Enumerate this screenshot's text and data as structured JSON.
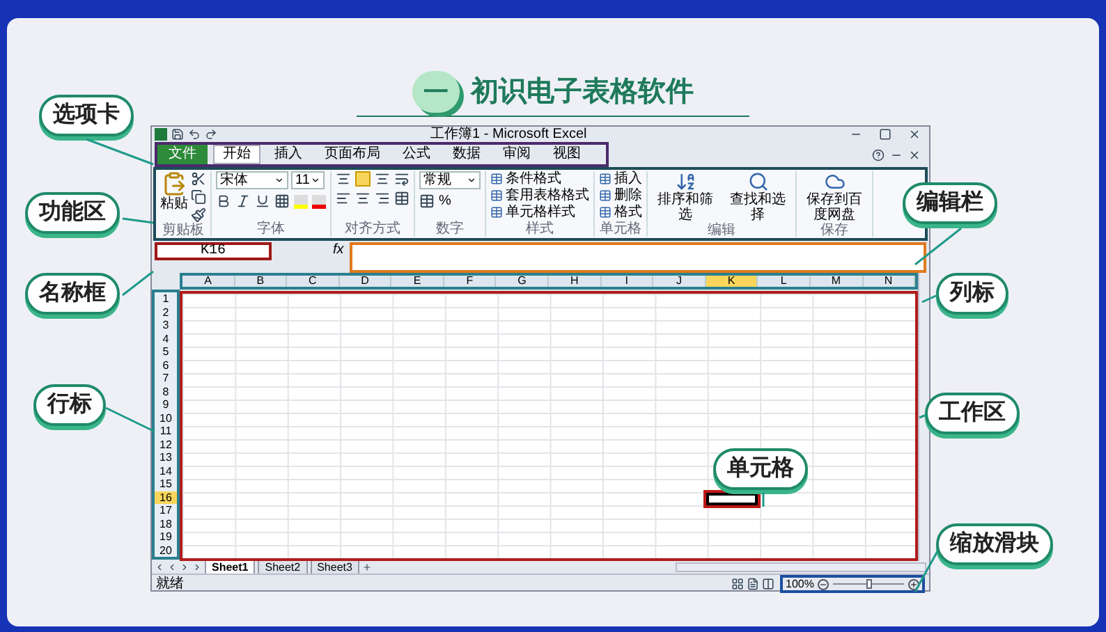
{
  "slide_title": {
    "number": "一",
    "text": "初识电子表格软件"
  },
  "excel": {
    "title": "工作簿1 - Microsoft Excel",
    "tabs": [
      {
        "label": "文件",
        "kind": "file",
        "selected": false
      },
      {
        "label": "开始",
        "kind": "tab",
        "selected": true
      },
      {
        "label": "插入",
        "kind": "tab",
        "selected": false
      },
      {
        "label": "页面布局",
        "kind": "tab",
        "selected": false
      },
      {
        "label": "公式",
        "kind": "tab",
        "selected": false
      },
      {
        "label": "数据",
        "kind": "tab",
        "selected": false
      },
      {
        "label": "审阅",
        "kind": "tab",
        "selected": false
      },
      {
        "label": "视图",
        "kind": "tab",
        "selected": false
      }
    ],
    "ribbon_groups": [
      {
        "kind": "clipboard",
        "label": "剪贴板",
        "items": [
          "粘贴"
        ]
      },
      {
        "kind": "font",
        "label": "字体",
        "items": [
          "宋体",
          "11"
        ]
      },
      {
        "kind": "align",
        "label": "对齐方式"
      },
      {
        "kind": "number",
        "label": "数字",
        "items": [
          "常规",
          "%"
        ]
      },
      {
        "kind": "list",
        "label": "样式",
        "items": [
          "条件格式",
          "套用表格格式",
          "单元格样式"
        ]
      },
      {
        "kind": "list",
        "label": "单元格",
        "items": [
          "插入",
          "删除",
          "格式"
        ]
      },
      {
        "kind": "big",
        "label": "编辑",
        "items": [
          "排序和筛选",
          "查找和选择"
        ]
      },
      {
        "kind": "big",
        "label": "保存",
        "items": [
          "保存到百度网盘"
        ]
      }
    ],
    "name_box": "K16",
    "fx": "fx",
    "columns": [
      {
        "label": "A",
        "selected": false
      },
      {
        "label": "B",
        "selected": false
      },
      {
        "label": "C",
        "selected": false
      },
      {
        "label": "D",
        "selected": false
      },
      {
        "label": "E",
        "selected": false
      },
      {
        "label": "F",
        "selected": false
      },
      {
        "label": "G",
        "selected": false
      },
      {
        "label": "H",
        "selected": false
      },
      {
        "label": "I",
        "selected": false
      },
      {
        "label": "J",
        "selected": false
      },
      {
        "label": "K",
        "selected": true
      },
      {
        "label": "L",
        "selected": false
      },
      {
        "label": "M",
        "selected": false
      },
      {
        "label": "N",
        "selected": false
      }
    ],
    "rows": [
      {
        "label": "1",
        "selected": false
      },
      {
        "label": "2",
        "selected": false
      },
      {
        "label": "3",
        "selected": false
      },
      {
        "label": "4",
        "selected": false
      },
      {
        "label": "5",
        "selected": false
      },
      {
        "label": "6",
        "selected": false
      },
      {
        "label": "7",
        "selected": false
      },
      {
        "label": "8",
        "selected": false
      },
      {
        "label": "9",
        "selected": false
      },
      {
        "label": "10",
        "selected": false
      },
      {
        "label": "11",
        "selected": false
      },
      {
        "label": "12",
        "selected": false
      },
      {
        "label": "13",
        "selected": false
      },
      {
        "label": "14",
        "selected": false
      },
      {
        "label": "15",
        "selected": false
      },
      {
        "label": "16",
        "selected": true
      },
      {
        "label": "17",
        "selected": false
      },
      {
        "label": "18",
        "selected": false
      },
      {
        "label": "19",
        "selected": false
      },
      {
        "label": "20",
        "selected": false
      }
    ],
    "sheets": [
      {
        "label": "Sheet1",
        "selected": true
      },
      {
        "label": "Sheet2",
        "selected": false
      },
      {
        "label": "Sheet3",
        "selected": false
      }
    ],
    "status": "就绪",
    "zoom": {
      "reading": "100%",
      "level": 0.5
    }
  },
  "callouts": [
    {
      "label": "选项卡"
    },
    {
      "label": "功能区"
    },
    {
      "label": "名称框"
    },
    {
      "label": "行标"
    },
    {
      "label": "编辑栏"
    },
    {
      "label": "列标"
    },
    {
      "label": "工作区"
    },
    {
      "label": "单元格"
    },
    {
      "label": "缩放滑块"
    }
  ]
}
